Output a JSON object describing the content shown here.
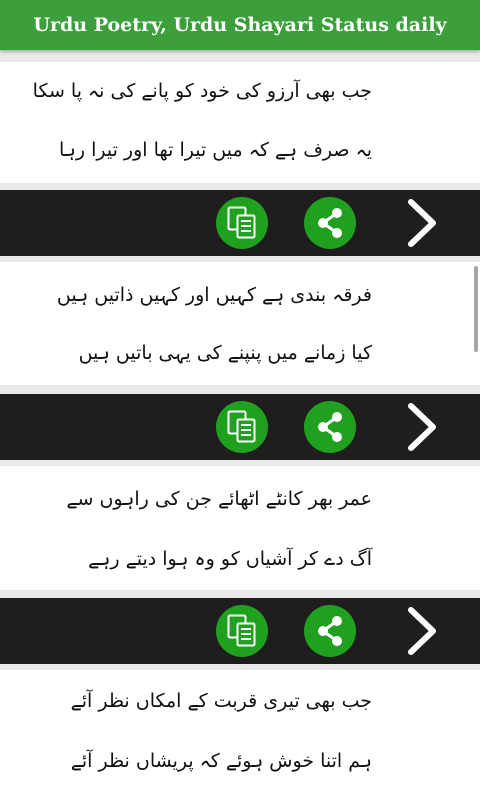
{
  "app_title": "Urdu Poetry, Urdu Shayari Status daily",
  "colors": {
    "appbar": "#3c9f3c",
    "action_bar": "#1f1d1d",
    "button": "#1fa01f"
  },
  "icons": {
    "copy": "copy-icon",
    "share": "share-icon",
    "next": "chevron-right-icon"
  },
  "poems": [
    {
      "line1": "جب بھی آرزو کی خود کو پانے کی نہ پا سکا",
      "line2": "یہ صرف ہے کہ میں تیرا تھا اور تیرا رہا"
    },
    {
      "line1": "فرقہ بندی ہے کہیں اور کہیں ذاتیں ہیں",
      "line2": "کیا زمانے میں پنپنے کی یہی باتیں ہیں"
    },
    {
      "line1": "عمر بھر کانٹے اٹھائے جن کی راہوں سے",
      "line2": "آگ دے کر آشیاں کو وہ ہوا دیتے رہے"
    },
    {
      "line1": "جب بھی تیری قربت کے امکاں نظر آئے",
      "line2": "ہم اتنا خوش ہوئے کہ پریشاں نظر آئے"
    }
  ]
}
